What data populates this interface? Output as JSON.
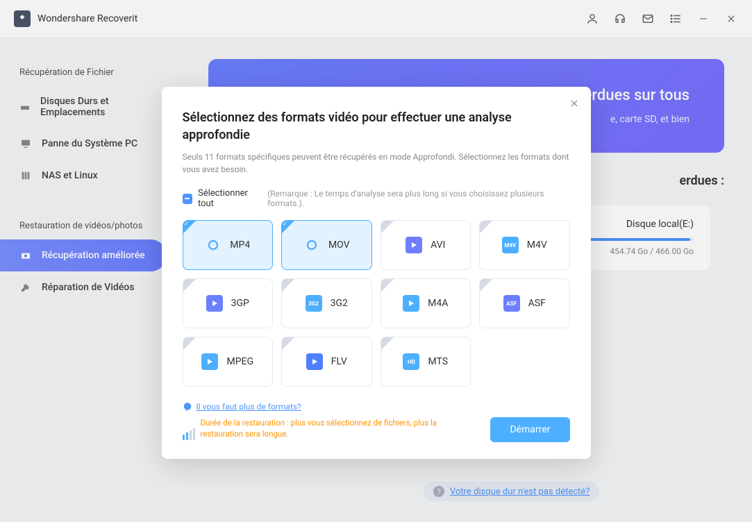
{
  "app": {
    "title": "Wondershare Recoverit"
  },
  "sidebar": {
    "section1": "Récupération de Fichier",
    "items1": [
      {
        "label": "Disques Durs et Emplacements"
      },
      {
        "label": "Panne du Système PC"
      },
      {
        "label": "NAS et Linux"
      }
    ],
    "section2": "Restauration de vidéos/photos",
    "items2": [
      {
        "label": "Récupération améliorée"
      },
      {
        "label": "Réparation de Vidéos"
      }
    ]
  },
  "banner": {
    "title_partial": "tos perdues sur tous",
    "sub_partial": "e, carte SD, et bien"
  },
  "content": {
    "heading_partial": "erdues :",
    "disk": {
      "name": "Disque local(E:)",
      "size": "454.74 Go / 466.00 Go",
      "fill_pct": 97
    },
    "footer_link": "Votre disque dur n'est pas détecté?"
  },
  "modal": {
    "title": "Sélectionnez des formats vidéo pour effectuer une analyse approfondie",
    "subtitle": "Seuls 11 formats spécifiques peuvent être récupérés en mode Approfondi. Sélectionnez les formats dont vous avez besoin.",
    "select_all": "Sélectionner tout",
    "select_all_note": "(Remarque : Le temps d'analyse sera plus long si vous choisissez plusieurs formats.).",
    "formats": [
      {
        "name": "MP4",
        "selected": true,
        "color": "#4dafff"
      },
      {
        "name": "MOV",
        "selected": true,
        "color": "#4dafff"
      },
      {
        "name": "AVI",
        "selected": false,
        "color": "#6b7fff"
      },
      {
        "name": "M4V",
        "selected": false,
        "color": "#4dafff",
        "badge": "M4V"
      },
      {
        "name": "3GP",
        "selected": false,
        "color": "#6b7fff"
      },
      {
        "name": "3G2",
        "selected": false,
        "color": "#4dafff",
        "badge": "3G2"
      },
      {
        "name": "M4A",
        "selected": false,
        "color": "#4dafff"
      },
      {
        "name": "ASF",
        "selected": false,
        "color": "#6b7fff",
        "badge": "ASF"
      },
      {
        "name": "MPEG",
        "selected": false,
        "color": "#4dafff"
      },
      {
        "name": "FLV",
        "selected": false,
        "color": "#4d7fff"
      },
      {
        "name": "MTS",
        "selected": false,
        "color": "#4dafff",
        "badge": "HD"
      }
    ],
    "more_link": "Il vous faut plus de formats?",
    "duration_note": "Durée de la restauration : plus vous sélectionnez de fichiers, plus la restauration sera longue.",
    "start": "Démarrer"
  }
}
